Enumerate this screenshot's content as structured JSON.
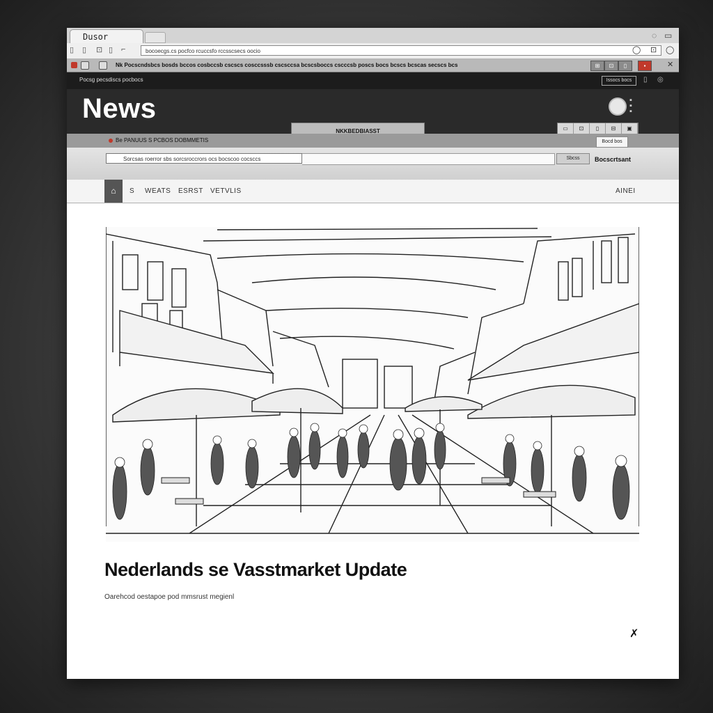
{
  "browser": {
    "tab_title": "Dusor",
    "url": "bocoecgs.cs pocfco rcuccsfo rccsscsecs oocio",
    "bookmarks_text": "Nk Pocscndsbcs bosds bccos cosbccsb cscscs cosccsssb cscsccsa bcscsboccs cscccsb poscs bocs bcscs bcscas secscs bcs"
  },
  "site": {
    "top_text": "Pocsg pecsdiscs pocbocs",
    "signin_label": "Issocs bocs",
    "logo": "News",
    "center_button": "NKKBEDBIASST",
    "mini_tools": [
      "▭",
      "⊡",
      "▯",
      "⊟",
      "▣"
    ],
    "tooltip": "Bocd bos",
    "notice": "Be PANUUS S PCBOS DOBMMETIS",
    "search_placeholder": "Sorcsas roerror sbs sorcsroccrors ocs bocscoo cocsccs",
    "search_button": "Sbcss",
    "search_right": "Bocscrtsant",
    "nav_home": "⌂",
    "nav_items": [
      "S",
      "WEATS",
      "ESRST",
      "VETVLIS"
    ],
    "nav_right": "AINEI"
  },
  "article": {
    "image_desc": "market-street-sketch",
    "headline": "Nederlands se Vasstmarket Update",
    "subline": "Oarehcod oestapoe pod mmsrust megienl",
    "close": "✗"
  }
}
